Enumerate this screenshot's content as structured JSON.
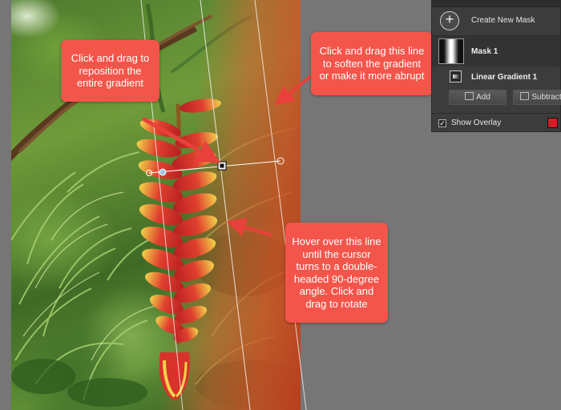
{
  "callouts": {
    "reposition": "Click and drag to reposition the entire gradient",
    "soften": "Click and drag this line to soften the gradient or make it more abrupt",
    "rotate": "Hover over this line until the cursor turns to a double-headed 90-degree angle. Click and drag to rotate"
  },
  "mask_panel": {
    "create_new_mask": "Create New Mask",
    "mask_name": "Mask 1",
    "gradient_name": "Linear Gradient 1",
    "add_label": "Add",
    "subtract_label": "Subtract",
    "show_overlay_label": "Show Overlay",
    "show_overlay_checked": true,
    "overlay_color": "#d01f27",
    "icons": [
      "plus-icon",
      "mask-thumbnail",
      "linear-gradient-icon",
      "add-icon",
      "subtract-icon",
      "checkbox-icon"
    ]
  },
  "colors": {
    "callout": "#f4554a",
    "canvas_background": "#767676",
    "panel_background": "#3c3c3c"
  }
}
